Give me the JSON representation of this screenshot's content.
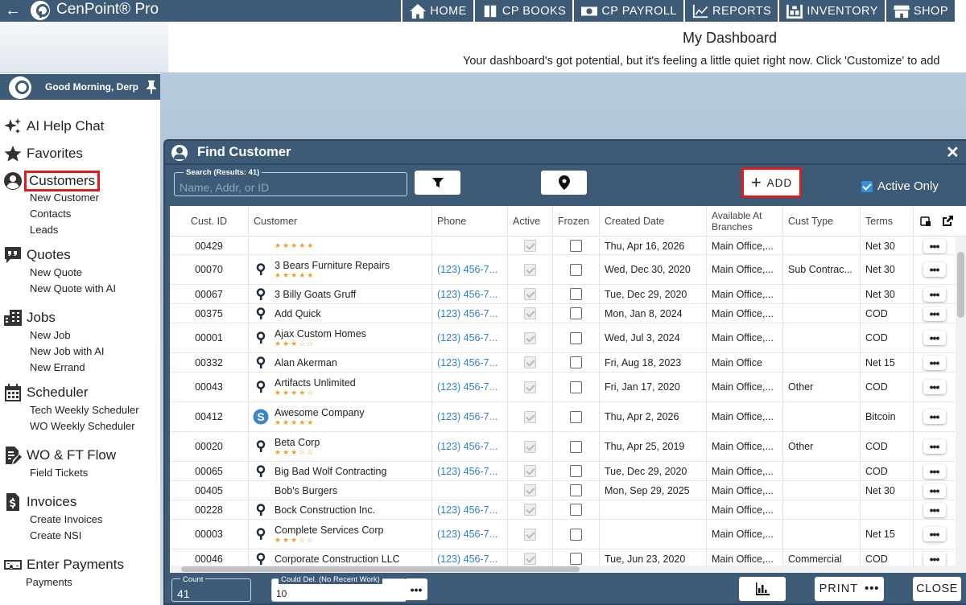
{
  "topbar": {
    "app_title": "CenPoint® Pro",
    "nav": [
      {
        "label": "HOME",
        "icon": "home-icon"
      },
      {
        "label": "CP BOOKS",
        "icon": "books-icon"
      },
      {
        "label": "CP PAYROLL",
        "icon": "payroll-icon"
      },
      {
        "label": "REPORTS",
        "icon": "reports-icon"
      },
      {
        "label": "INVENTORY",
        "icon": "inventory-icon"
      },
      {
        "label": "SHOP",
        "icon": "shop-icon"
      }
    ]
  },
  "dashboard": {
    "title": "My Dashboard",
    "subtitle": "Your dashboard's got potential, but it's feeling a little quiet right now. Click 'Customize' to add"
  },
  "sidebar": {
    "greeting": "Good Morning, Derp",
    "sections": [
      {
        "label": "AI Help Chat",
        "icon": "sparkle-icon",
        "items": []
      },
      {
        "label": "Favorites",
        "icon": "star-icon",
        "items": []
      },
      {
        "label": "Customers",
        "icon": "user-circle-icon",
        "items": [
          "New Customer",
          "Contacts",
          "Leads"
        ]
      },
      {
        "label": "Quotes",
        "icon": "quote-icon",
        "items": [
          "New Quote",
          "New Quote with AI"
        ]
      },
      {
        "label": "Jobs",
        "icon": "building-icon",
        "items": [
          "New Job",
          "New Job with AI",
          "New Errand"
        ]
      },
      {
        "label": "Scheduler",
        "icon": "calendar-icon",
        "items": [
          "Tech Weekly Scheduler",
          "WO Weekly Scheduler"
        ]
      },
      {
        "label": "WO & FT Flow",
        "icon": "edit-doc-icon",
        "items": [
          "Field Tickets"
        ]
      },
      {
        "label": "Invoices",
        "icon": "invoice-icon",
        "items": [
          "Create Invoices",
          "Create NSI"
        ]
      },
      {
        "label": "Enter Payments",
        "icon": "cash-icon",
        "items": [
          "Payments"
        ]
      }
    ]
  },
  "find_customer": {
    "title": "Find Customer",
    "search_legend": "Search (Results: 41)",
    "search_placeholder": "Name, Addr, or ID",
    "add_label": "ADD",
    "active_only_label": "Active Only",
    "active_only_checked": true,
    "columns": [
      "Cust. ID",
      "Customer",
      "Phone",
      "Active",
      "Frozen",
      "Created Date",
      "Available At Branches",
      "Cust Type",
      "Terms"
    ],
    "rows": [
      {
        "id": "00429",
        "name": "",
        "stars": "★★★★★",
        "logo": "none",
        "phone": "",
        "created": "Thu, Apr 16, 2026",
        "branches": "Main Office,...",
        "type": "",
        "terms": "Net 30"
      },
      {
        "id": "00070",
        "name": "3 Bears Furniture Repairs",
        "stars": "★★★★★",
        "logo": "cp",
        "phone": "(123) 456-7...",
        "created": "Wed, Dec 30, 2020",
        "branches": "Main Office,...",
        "type": "Sub Contrac...",
        "terms": "Net 30"
      },
      {
        "id": "00067",
        "name": "3 Billy Goats Gruff",
        "stars": "",
        "logo": "cp",
        "phone": "(123) 456-7...",
        "created": "Tue, Dec 29, 2020",
        "branches": "Main Office,...",
        "type": "",
        "terms": "Net 30"
      },
      {
        "id": "00375",
        "name": "Add Quick",
        "stars": "",
        "logo": "cp",
        "phone": "(123) 456-7...",
        "created": "Mon, Jan 8, 2024",
        "branches": "Main Office,...",
        "type": "",
        "terms": "COD"
      },
      {
        "id": "00001",
        "name": "Ajax Custom Homes",
        "stars": "★★★☆☆",
        "logo": "cp",
        "phone": "(123) 456-7...",
        "created": "Wed, Jul 3, 2024",
        "branches": "Main Office,...",
        "type": "",
        "terms": "COD"
      },
      {
        "id": "00332",
        "name": "Alan Akerman",
        "stars": "",
        "logo": "cp",
        "phone": "(123) 456-7...",
        "created": "Fri, Aug 18, 2023",
        "branches": "Main Office",
        "type": "",
        "terms": "Net 15"
      },
      {
        "id": "00043",
        "name": "Artifacts Unlimited",
        "stars": "★★★★☆",
        "logo": "cp",
        "phone": "(123) 456-7...",
        "created": "Fri, Jan 17, 2020",
        "branches": "Main Office,...",
        "type": "Other",
        "terms": "COD"
      },
      {
        "id": "00412",
        "name": "Awesome Company",
        "stars": "★★★★★",
        "logo": "s",
        "phone": "(123) 456-7...",
        "created": "Thu, Apr 2, 2026",
        "branches": "Main Office,...",
        "type": "",
        "terms": "Bitcoin"
      },
      {
        "id": "00020",
        "name": "Beta Corp",
        "stars": "★★★☆☆",
        "logo": "cp",
        "phone": "(123) 456-7...",
        "created": "Thu, Apr 25, 2019",
        "branches": "Main Office,...",
        "type": "Other",
        "terms": "COD"
      },
      {
        "id": "00065",
        "name": "Big Bad Wolf Contracting",
        "stars": "",
        "logo": "cp",
        "phone": "(123) 456-7...",
        "created": "Tue, Dec 29, 2020",
        "branches": "Main Office,...",
        "type": "",
        "terms": "COD"
      },
      {
        "id": "00405",
        "name": "Bob's Burgers",
        "stars": "",
        "logo": "none",
        "phone": "",
        "created": "Mon, Sep 29, 2025",
        "branches": "Main Office,...",
        "type": "",
        "terms": "Net 30"
      },
      {
        "id": "00228",
        "name": "Bock Construction Inc.",
        "stars": "",
        "logo": "cp",
        "phone": "(123) 456-7...",
        "created": "",
        "branches": "Main Office,...",
        "type": "",
        "terms": ""
      },
      {
        "id": "00003",
        "name": "Complete Services Corp",
        "stars": "★★★☆☆",
        "logo": "cp",
        "phone": "(123) 456-7...",
        "created": "",
        "branches": "Main Office,...",
        "type": "",
        "terms": "Net 15"
      },
      {
        "id": "00046",
        "name": "Corporate Construction LLC",
        "stars": "",
        "logo": "cp",
        "phone": "(123) 456-7...",
        "created": "Tue, Jun 23, 2020",
        "branches": "Main Office,...",
        "type": "Commercial",
        "terms": "COD"
      }
    ],
    "count_label": "Count",
    "count_value": "41",
    "could_del_label": "Could Del. (No Recent Work)",
    "could_del_value": "10",
    "print_label": "PRINT",
    "close_label": "CLOSE"
  },
  "colors": {
    "header_blue": "#3d5a76",
    "highlight_red": "#e01b1b",
    "link_blue": "#2f7fd0",
    "star_orange": "#f0a020"
  }
}
